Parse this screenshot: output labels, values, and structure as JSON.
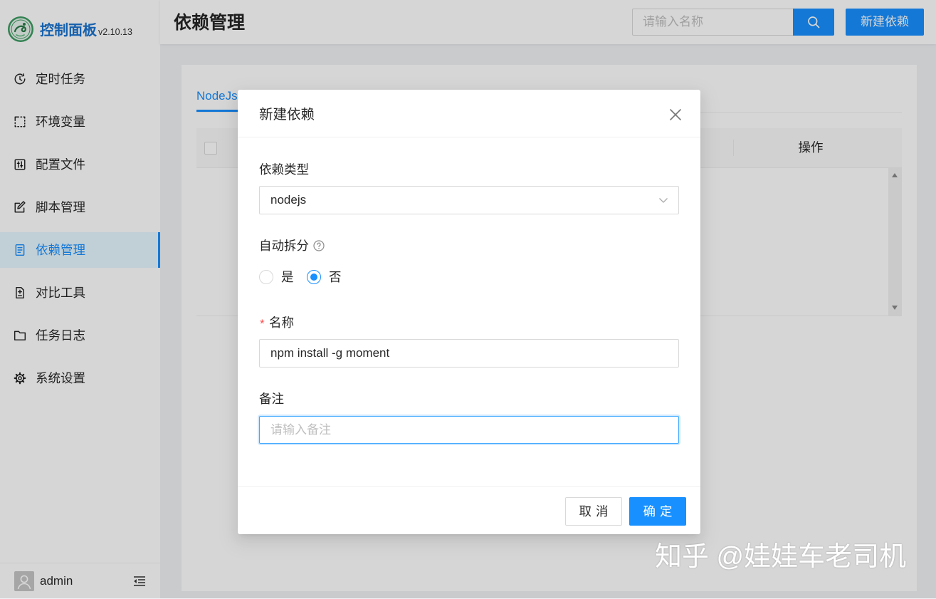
{
  "app": {
    "logo_title": "控制面板",
    "version": "v2.10.13",
    "logo_icon": "qinglong-logo-icon"
  },
  "sidebar": {
    "items": [
      {
        "label": "定时任务",
        "icon": "clock-icon",
        "selected": false
      },
      {
        "label": "环境变量",
        "icon": "variable-icon",
        "selected": false
      },
      {
        "label": "配置文件",
        "icon": "control-icon",
        "selected": false
      },
      {
        "label": "脚本管理",
        "icon": "edit-icon",
        "selected": false
      },
      {
        "label": "依赖管理",
        "icon": "file-text-icon",
        "selected": true
      },
      {
        "label": "对比工具",
        "icon": "diff-icon",
        "selected": false
      },
      {
        "label": "任务日志",
        "icon": "folder-icon",
        "selected": false
      },
      {
        "label": "系统设置",
        "icon": "gear-icon",
        "selected": false
      }
    ],
    "user": {
      "name": "admin",
      "avatar_icon": "user-icon",
      "collapse_icon": "menu-fold-icon"
    }
  },
  "header": {
    "title": "依赖管理",
    "search": {
      "placeholder": "请输入名称",
      "button_icon": "search-icon"
    },
    "new_button": "新建依赖"
  },
  "main": {
    "tabs": [
      {
        "label": "NodeJs",
        "active": true
      }
    ],
    "table": {
      "columns": [
        {
          "label": "操作"
        }
      ]
    }
  },
  "modal": {
    "title": "新建依赖",
    "close_icon": "close-icon",
    "fields": {
      "type": {
        "label": "依赖类型",
        "value": "nodejs",
        "icon": "chevron-down-icon"
      },
      "auto_split": {
        "label": "自动拆分",
        "help_icon": "question-circle-icon",
        "options": [
          {
            "label": "是",
            "checked": false
          },
          {
            "label": "否",
            "checked": true
          }
        ]
      },
      "name": {
        "label": "名称",
        "required_mark": "*",
        "value": "npm install -g moment"
      },
      "remark": {
        "label": "备注",
        "placeholder": "请输入备注",
        "focused": true
      }
    },
    "buttons": {
      "cancel": "取消",
      "ok": "确定"
    }
  },
  "watermark": "知乎 @娃娃车老司机",
  "colors": {
    "accent": "#1890ff",
    "required": "#ff4d4f",
    "logo_green": "#3d9b62"
  }
}
